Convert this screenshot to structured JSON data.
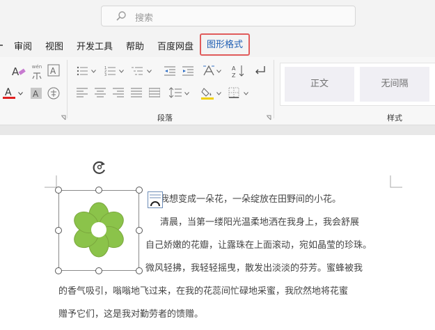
{
  "search": {
    "placeholder": "搜索"
  },
  "tabs": [
    {
      "label": "审阅"
    },
    {
      "label": "视图"
    },
    {
      "label": "开发工具"
    },
    {
      "label": "帮助"
    },
    {
      "label": "百度网盘"
    },
    {
      "label": "图形格式",
      "active": true
    }
  ],
  "ribbon": {
    "paragraph_group_label": "段落",
    "styles_group_label": "样式",
    "styles": [
      {
        "label": "正文"
      },
      {
        "label": "无间隔"
      }
    ],
    "phonetic_icon_text": "wén",
    "colors": {
      "font_color_bar": "#e02020",
      "highlight_bar": "#f0d000",
      "active_tab_border": "#e05b5b",
      "active_tab_text": "#1f5fb4",
      "flower": "#8bc34a"
    }
  },
  "document": {
    "line1": "我想变成一朵花，一朵绽放在田野间的小花。",
    "line2": "清晨，当第一缕阳光温柔地洒在我身上，我会舒展",
    "line3": "自己娇嫩的花瓣，让露珠在上面滚动，宛如晶莹的珍珠。",
    "line4": "微风轻拂，我轻轻摇曳，散发出淡淡的芬芳。蜜蜂被我",
    "line5": "的香气吸引，嗡嗡地飞过来，在我的花蕊间忙碌地采蜜，我欣然地将花蜜",
    "line6": "赠予它们，这是我对勤劳者的馈赠。"
  }
}
